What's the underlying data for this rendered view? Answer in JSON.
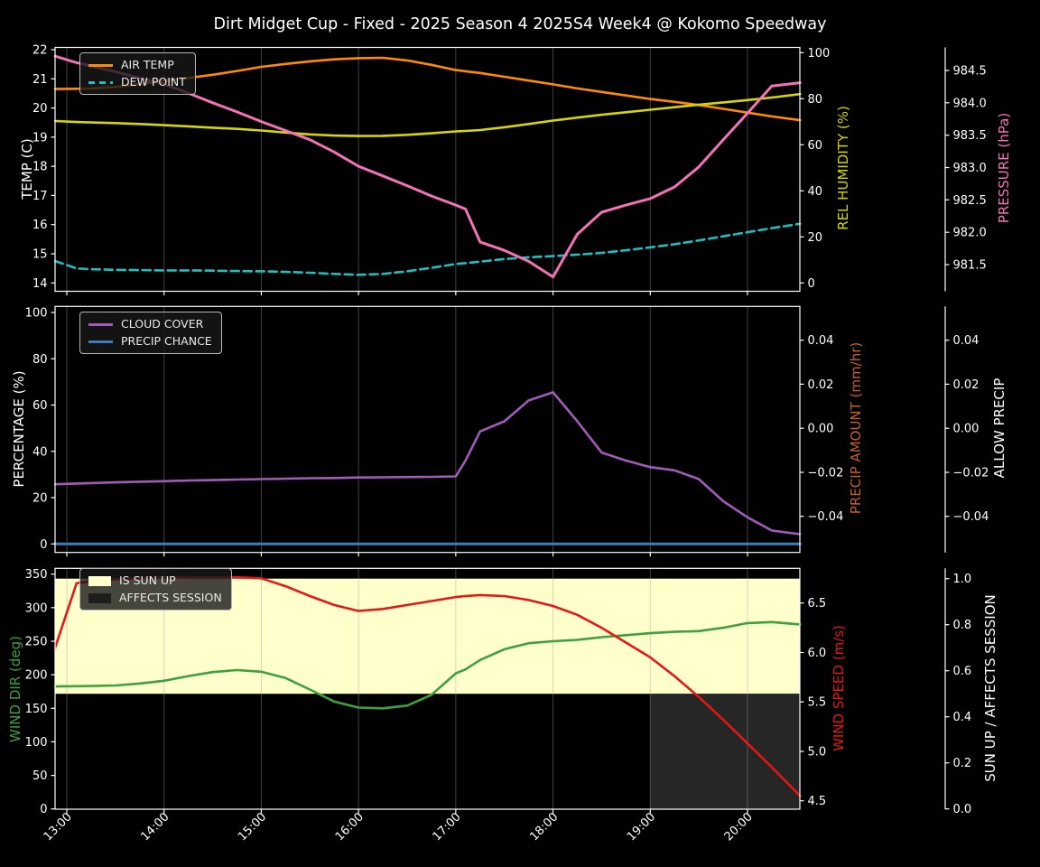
{
  "title": "Dirt Midget Cup - Fixed - 2025 Season 4 2025S4 Week4 @ Kokomo Speedway",
  "x_axis": {
    "labels": [
      "13:00",
      "14:00",
      "15:00",
      "16:00",
      "17:00",
      "18:00",
      "19:00",
      "20:00"
    ],
    "hours": [
      13,
      14,
      15,
      16,
      17,
      18,
      19,
      20
    ]
  },
  "chart_data": [
    {
      "type": "line",
      "x_hours": [
        12.88,
        13.1,
        13.25,
        13.5,
        13.75,
        14.0,
        14.25,
        14.5,
        14.75,
        15.0,
        15.25,
        15.5,
        15.75,
        16.0,
        16.25,
        16.5,
        16.75,
        17.0,
        17.1,
        17.25,
        17.5,
        17.75,
        18.0,
        18.25,
        18.5,
        18.75,
        19.0,
        19.25,
        19.5,
        19.75,
        20.0,
        20.25,
        20.54
      ],
      "axes": [
        {
          "scale": "temp",
          "side": "left",
          "title": "TEMP (C)",
          "color": "#ffffff",
          "tick_values": [
            14,
            15,
            16,
            17,
            18,
            19,
            20,
            21,
            22
          ],
          "tick_labels": [
            "14",
            "15",
            "16",
            "17",
            "18",
            "19",
            "20",
            "21",
            "22"
          ]
        },
        {
          "scale": "hum",
          "side": "right",
          "title": "REL HUMIDITY (%)",
          "color": "#d6d600",
          "tick_values": [
            0,
            20,
            40,
            60,
            80,
            100
          ],
          "tick_labels": [
            "0",
            "20",
            "40",
            "60",
            "80",
            "100"
          ]
        },
        {
          "scale": "pres",
          "side": "far_right",
          "title": "PRESSURE (hPa)",
          "color": "#f274b6",
          "tick_values": [
            981.5,
            982.0,
            982.5,
            983.0,
            983.5,
            984.0,
            984.5
          ],
          "tick_labels": [
            "981.5",
            "982.0",
            "982.5",
            "983.0",
            "983.5",
            "984.0",
            "984.5"
          ]
        }
      ],
      "series": [
        {
          "name": "AIR TEMP",
          "axis": "temp",
          "color": "#ff8c00",
          "width": 2.6,
          "dash": false,
          "values": [
            20.65,
            20.66,
            20.67,
            20.72,
            20.82,
            20.93,
            21.03,
            21.14,
            21.27,
            21.41,
            21.51,
            21.6,
            21.67,
            21.71,
            21.72,
            21.63,
            21.48,
            21.3,
            21.26,
            21.2,
            21.07,
            20.94,
            20.81,
            20.67,
            20.55,
            20.43,
            20.31,
            20.21,
            20.1,
            19.97,
            19.84,
            19.71,
            19.58
          ]
        },
        {
          "name": "DEW POINT",
          "axis": "temp",
          "color": "#20bfbf",
          "width": 2.6,
          "dash": true,
          "values": [
            14.75,
            14.5,
            14.47,
            14.45,
            14.44,
            14.43,
            14.43,
            14.42,
            14.41,
            14.4,
            14.38,
            14.35,
            14.31,
            14.28,
            14.31,
            14.4,
            14.52,
            14.65,
            14.68,
            14.73,
            14.82,
            14.88,
            14.92,
            14.97,
            15.03,
            15.12,
            15.22,
            15.33,
            15.46,
            15.6,
            15.74,
            15.88,
            16.03
          ]
        },
        {
          "name": "REL HUMIDITY",
          "axis": "hum",
          "color": "#d6d600",
          "width": 2.6,
          "dash": false,
          "values": [
            70.3,
            69.9,
            69.7,
            69.4,
            69.0,
            68.5,
            68.0,
            67.4,
            66.9,
            66.2,
            65.3,
            64.5,
            64.0,
            63.8,
            63.9,
            64.3,
            65.0,
            65.8,
            66.0,
            66.4,
            67.6,
            69.0,
            70.5,
            71.8,
            73.0,
            74.1,
            75.2,
            76.3,
            77.4,
            78.4,
            79.4,
            80.5,
            82.0
          ]
        },
        {
          "name": "PRESSURE",
          "axis": "pres",
          "color": "#f274b6",
          "width": 3.0,
          "dash": false,
          "values": [
            984.72,
            984.62,
            984.57,
            984.48,
            984.38,
            984.29,
            984.15,
            984.0,
            983.86,
            983.71,
            983.57,
            983.43,
            983.24,
            983.02,
            982.87,
            982.72,
            982.56,
            982.42,
            982.36,
            981.85,
            981.72,
            981.55,
            981.31,
            981.97,
            982.31,
            982.42,
            982.52,
            982.7,
            983.01,
            983.43,
            983.84,
            984.26,
            984.31
          ]
        }
      ],
      "regions": [],
      "legend": {
        "items": [
          {
            "label": "AIR TEMP",
            "color": "#ff8c00",
            "swatch": "line"
          },
          {
            "label": "DEW POINT",
            "color": "#20bfbf",
            "swatch": "dash"
          }
        ]
      }
    },
    {
      "type": "line",
      "x_hours": [
        12.88,
        13.1,
        13.25,
        13.5,
        13.75,
        14.0,
        14.25,
        14.5,
        14.75,
        15.0,
        15.25,
        15.5,
        15.75,
        16.0,
        16.25,
        16.5,
        16.75,
        17.0,
        17.1,
        17.25,
        17.5,
        17.75,
        18.0,
        18.25,
        18.5,
        18.75,
        19.0,
        19.25,
        19.5,
        19.75,
        20.0,
        20.25,
        20.54
      ],
      "axes": [
        {
          "scale": "pct",
          "side": "left",
          "title": "PERCENTAGE (%)",
          "color": "#ffffff",
          "tick_values": [
            0,
            20,
            40,
            60,
            80,
            100
          ],
          "tick_labels": [
            "0",
            "20",
            "40",
            "60",
            "80",
            "100"
          ]
        },
        {
          "scale": "pamt",
          "side": "right",
          "title": "PRECIP AMOUNT (mm/hr)",
          "color": "#c0602a",
          "tick_values": [
            -0.04,
            -0.02,
            0.0,
            0.02,
            0.04
          ],
          "tick_labels": [
            "−0.04",
            "−0.02",
            "0.00",
            "0.02",
            "0.04"
          ]
        },
        {
          "scale": "pamt",
          "side": "far_right",
          "title": "ALLOW PRECIP",
          "color": "#ffffff",
          "tick_values": [
            -0.04,
            -0.02,
            0.0,
            0.02,
            0.04
          ],
          "tick_labels": [
            "−0.04",
            "−0.02",
            "0.00",
            "0.02",
            "0.04"
          ]
        }
      ],
      "series": [
        {
          "name": "CLOUD COVER",
          "axis": "pct",
          "color": "#a05cb8",
          "width": 2.6,
          "dash": false,
          "values": [
            25.8,
            26.1,
            26.3,
            26.6,
            26.9,
            27.1,
            27.4,
            27.6,
            27.8,
            28.0,
            28.2,
            28.4,
            28.5,
            28.7,
            28.8,
            28.9,
            29.0,
            29.2,
            36.0,
            48.6,
            53.0,
            62.0,
            65.5,
            53.0,
            39.5,
            36.0,
            33.2,
            31.8,
            28.0,
            18.5,
            11.5,
            5.8,
            4.2
          ]
        },
        {
          "name": "PRECIP CHANCE",
          "axis": "pct",
          "color": "#3d7eba",
          "width": 3.0,
          "dash": false,
          "values": [
            0,
            0,
            0,
            0,
            0,
            0,
            0,
            0,
            0,
            0,
            0,
            0,
            0,
            0,
            0,
            0,
            0,
            0,
            0,
            0,
            0,
            0,
            0,
            0,
            0,
            0,
            0,
            0,
            0,
            0,
            0,
            0,
            0
          ]
        }
      ],
      "regions": [],
      "legend": {
        "items": [
          {
            "label": "CLOUD COVER",
            "color": "#a05cb8",
            "swatch": "line"
          },
          {
            "label": "PRECIP CHANCE",
            "color": "#3d7eba",
            "swatch": "line"
          }
        ]
      }
    },
    {
      "type": "line",
      "x_hours": [
        12.88,
        13.1,
        13.25,
        13.5,
        13.75,
        14.0,
        14.25,
        14.5,
        14.75,
        15.0,
        15.25,
        15.5,
        15.75,
        16.0,
        16.25,
        16.5,
        16.75,
        17.0,
        17.1,
        17.25,
        17.5,
        17.75,
        18.0,
        18.25,
        18.5,
        18.75,
        19.0,
        19.25,
        19.5,
        19.75,
        20.0,
        20.25,
        20.54
      ],
      "axes": [
        {
          "scale": "wdir",
          "side": "left",
          "title": "WIND DIR (deg)",
          "color": "#3fa03f",
          "tick_values": [
            0,
            50,
            100,
            150,
            200,
            250,
            300,
            350
          ],
          "tick_labels": [
            "0",
            "50",
            "100",
            "150",
            "200",
            "250",
            "300",
            "350"
          ]
        },
        {
          "scale": "wspd",
          "side": "right",
          "title": "WIND SPEED (m/s)",
          "color": "#e41818",
          "tick_values": [
            4.5,
            5.0,
            5.5,
            6.0,
            6.5
          ],
          "tick_labels": [
            "4.5",
            "5.0",
            "5.5",
            "6.0",
            "6.5"
          ]
        },
        {
          "scale": "sun",
          "side": "far_right",
          "title": "SUN UP / AFFECTS SESSION",
          "color": "#ffffff",
          "tick_values": [
            0.0,
            0.2,
            0.4,
            0.6,
            0.8,
            1.0
          ],
          "tick_labels": [
            "0.0",
            "0.2",
            "0.4",
            "0.6",
            "0.8",
            "1.0"
          ]
        }
      ],
      "series": [
        {
          "name": "WIND DIR",
          "axis": "wdir",
          "color": "#3fa03f",
          "width": 2.6,
          "dash": false,
          "values": [
            182.5,
            183.0,
            183.2,
            184.0,
            187.0,
            191.0,
            198.0,
            204.0,
            207.0,
            204.5,
            195.0,
            178.0,
            160.0,
            151.0,
            150.0,
            154.0,
            170.0,
            202.0,
            208.0,
            222.0,
            238.0,
            247.0,
            250.0,
            252.0,
            256.0,
            259.0,
            262.0,
            264.0,
            265.0,
            270.0,
            277.0,
            278.5,
            275.0
          ]
        },
        {
          "name": "WIND SPEED",
          "axis": "wspd",
          "color": "#e41818",
          "width": 2.6,
          "dash": false,
          "values": [
            6.05,
            6.7,
            6.72,
            6.74,
            6.75,
            6.76,
            6.76,
            6.76,
            6.76,
            6.75,
            6.67,
            6.57,
            6.48,
            6.42,
            6.44,
            6.48,
            6.52,
            6.56,
            6.57,
            6.58,
            6.57,
            6.53,
            6.47,
            6.38,
            6.25,
            6.1,
            5.95,
            5.76,
            5.55,
            5.32,
            5.08,
            4.84,
            4.55
          ]
        }
      ],
      "regions": [
        {
          "name": "IS SUN UP",
          "axis": "sun",
          "x": [
            12.879,
            20.539
          ],
          "y": [
            0.5,
            1.0
          ],
          "color": "#ffffcc"
        },
        {
          "name": "AFFECTS SESSION",
          "axis": "sun",
          "x": [
            19.0,
            20.539
          ],
          "y": [
            0.0,
            0.5
          ],
          "color": "#262626"
        }
      ],
      "legend": {
        "items": [
          {
            "label": "IS SUN UP",
            "color": "#ffffcc",
            "swatch": "patch"
          },
          {
            "label": "AFFECTS SESSION",
            "color": "#1e1e1e",
            "swatch": "patch"
          }
        ]
      }
    }
  ]
}
